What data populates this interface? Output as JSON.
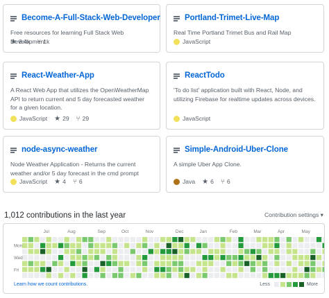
{
  "repos": [
    {
      "name": "Become-A-Full-Stack-Web-Developer",
      "description": "Free resources for learning Full Stack Web Development",
      "language": "",
      "lang_color": "",
      "stars": "8.4k",
      "forks": "1k"
    },
    {
      "name": "Portland-Trimet-Live-Map",
      "description": "Real Time Portland Trimet Bus and Rail Map",
      "language": "JavaScript",
      "lang_color": "#f1e05a",
      "stars": "",
      "forks": ""
    },
    {
      "name": "React-Weather-App",
      "description": "A React Web App that utilizes the OpenWeatherMap API to return current and 5 day forecasted weather for a given location.",
      "language": "JavaScript",
      "lang_color": "#f1e05a",
      "stars": "29",
      "forks": "29"
    },
    {
      "name": "ReactTodo",
      "description": "'To do list' application built with React, Node, and utilizing Firebase for realtime updates across devices.",
      "language": "JavaScript",
      "lang_color": "#f1e05a",
      "stars": "",
      "forks": ""
    },
    {
      "name": "node-async-weather",
      "description": "Node Weather Application - Returns the current weather and/or 5 day forecast in the cmd prompt",
      "language": "JavaScript",
      "lang_color": "#f1e05a",
      "stars": "4",
      "forks": "6"
    },
    {
      "name": "Simple-Android-Uber-Clone",
      "description": "A simple Uber App Clone.",
      "language": "Java",
      "lang_color": "#b07219",
      "stars": "6",
      "forks": "6"
    }
  ],
  "contributions": {
    "title": "1,012 contributions in the last year",
    "settings_label": "Contribution settings ▾",
    "months": [
      "Jul",
      "Aug",
      "Sep",
      "Oct",
      "Nov",
      "Dec",
      "Jan",
      "Feb",
      "Mar",
      "Apr",
      "May",
      "Jun"
    ],
    "days": [
      "Mon",
      "Wed",
      "Fri"
    ],
    "learn_link": "Learn how we count contributions.",
    "less_label": "Less",
    "more_label": "More",
    "level_colors": [
      "#ebedf0",
      "#c6e48b",
      "#7bc96f",
      "#239a3b",
      "#196127"
    ]
  }
}
